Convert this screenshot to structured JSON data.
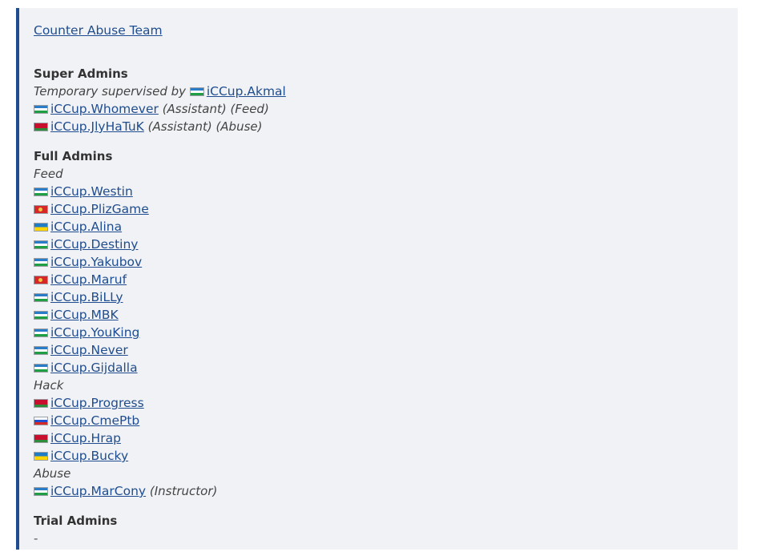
{
  "team_title": "Counter Abuse Team",
  "super_admins": {
    "heading": "Super Admins",
    "supervised": {
      "prefix": "Temporary supervised by",
      "flag": "uz",
      "name": "iCCup.Akmal"
    },
    "members": [
      {
        "flag": "uz",
        "name": "iCCup.Whomever",
        "note": "(Assistant) (Feed)"
      },
      {
        "flag": "by",
        "name": "iCCup.JlyHaTuK",
        "note": "(Assistant) (Abuse)"
      }
    ]
  },
  "full_admins": {
    "heading": "Full Admins",
    "groups": [
      {
        "label": "Feed",
        "members": [
          {
            "flag": "uz",
            "name": "iCCup.Westin"
          },
          {
            "flag": "kg",
            "name": "iCCup.PlizGame"
          },
          {
            "flag": "ua",
            "name": "iCCup.Alina"
          },
          {
            "flag": "uz",
            "name": "iCCup.Destiny"
          },
          {
            "flag": "uz",
            "name": "iCCup.Yakubov"
          },
          {
            "flag": "kg",
            "name": "iCCup.Maruf"
          },
          {
            "flag": "uz",
            "name": "iCCup.BiLLy"
          },
          {
            "flag": "uz",
            "name": "iCCup.MBK"
          },
          {
            "flag": "uz",
            "name": "iCCup.YouKing"
          },
          {
            "flag": "uz",
            "name": "iCCup.Never"
          },
          {
            "flag": "uz",
            "name": "iCCup.Gijdalla"
          }
        ]
      },
      {
        "label": "Hack",
        "members": [
          {
            "flag": "by",
            "name": "iCCup.Progress"
          },
          {
            "flag": "ru",
            "name": "iCCup.CmePtb"
          },
          {
            "flag": "by",
            "name": "iCCup.Hrap"
          },
          {
            "flag": "ua",
            "name": "iCCup.Bucky"
          }
        ]
      },
      {
        "label": "Abuse",
        "members": [
          {
            "flag": "uz",
            "name": "iCCup.MarCony",
            "note": "(Instructor)"
          }
        ]
      }
    ]
  },
  "trial_admins": {
    "heading": "Trial Admins",
    "value": "-"
  },
  "colors": {
    "link": "#1f4d8f",
    "panel_bg": "#f0f2f5",
    "accent_border": "#1f4d8f"
  }
}
